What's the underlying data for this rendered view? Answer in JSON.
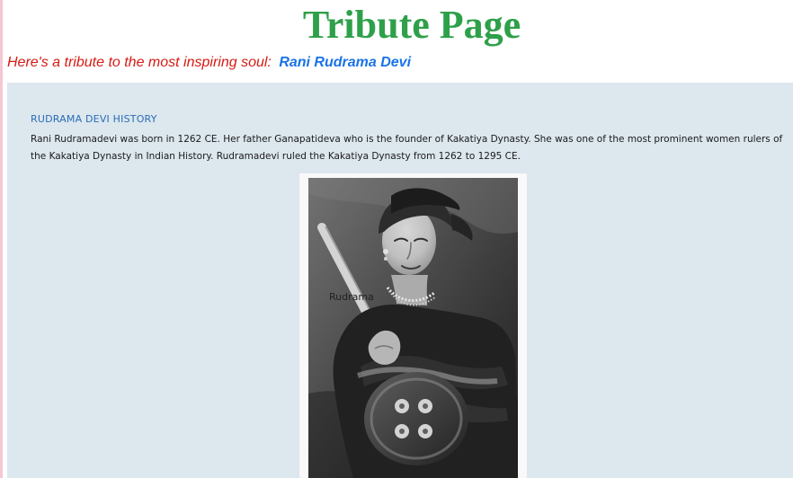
{
  "header": {
    "title": "Tribute Page"
  },
  "tagline": {
    "text": "Here's a tribute to the most inspiring soul:",
    "name": "Rani Rudrama Devi"
  },
  "history": {
    "heading": "RUDRAMA DEVI HISTORY",
    "paragraph": "Rani Rudramadevi was born in 1262 CE. Her father Ganapatideva who is the founder of Kakatiya Dynasty. She was one of the most prominent women rulers of the Kakatiya Dynasty in Indian History. Rudramadevi ruled the Kakatiya Dynasty from 1262 to 1295 CE."
  },
  "image": {
    "caption": "Rudrama"
  },
  "colors": {
    "title": "#2ea04a",
    "tagline": "#d51a12",
    "highlight": "#1a73e8",
    "panel_bg": "#dce7ee",
    "section_heading": "#2a6db6"
  }
}
